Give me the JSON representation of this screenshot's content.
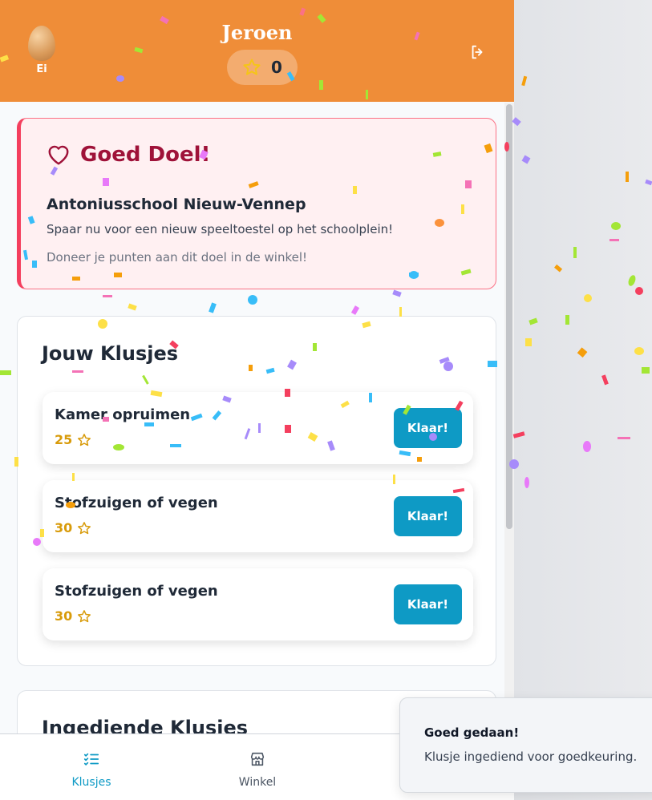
{
  "header": {
    "avatar_label": "Ei",
    "username": "Jeroen",
    "points": "0"
  },
  "goal": {
    "title": "Goed Doel!",
    "school": "Antoniusschool Nieuw-Vennep",
    "description": "Spaar nu voor een nieuw speeltoestel op het schoolplein!",
    "hint": "Doneer je punten aan dit doel in de winkel!"
  },
  "chores": {
    "title": "Jouw Klusjes",
    "items": [
      {
        "name": "Kamer opruimen",
        "points": "25",
        "button": "Klaar!"
      },
      {
        "name": "Stofzuigen of vegen",
        "points": "30",
        "button": "Klaar!"
      },
      {
        "name": "Stofzuigen of vegen",
        "points": "30",
        "button": "Klaar!"
      }
    ]
  },
  "submitted": {
    "title": "Ingediende Klusjes"
  },
  "nav": {
    "items": [
      {
        "label": "Klusjes",
        "icon": "checklist-icon",
        "active": true
      },
      {
        "label": "Winkel",
        "icon": "store-icon",
        "active": false
      }
    ]
  },
  "toast": {
    "title": "Goed gedaan!",
    "message": "Klusje ingediend voor goedkeuring."
  },
  "colors": {
    "header": "#ef8d38",
    "accent": "#0e9ac5",
    "goal_text": "#9f1239",
    "goal_bg": "#fff0f2",
    "points_star": "#d89b0b"
  }
}
